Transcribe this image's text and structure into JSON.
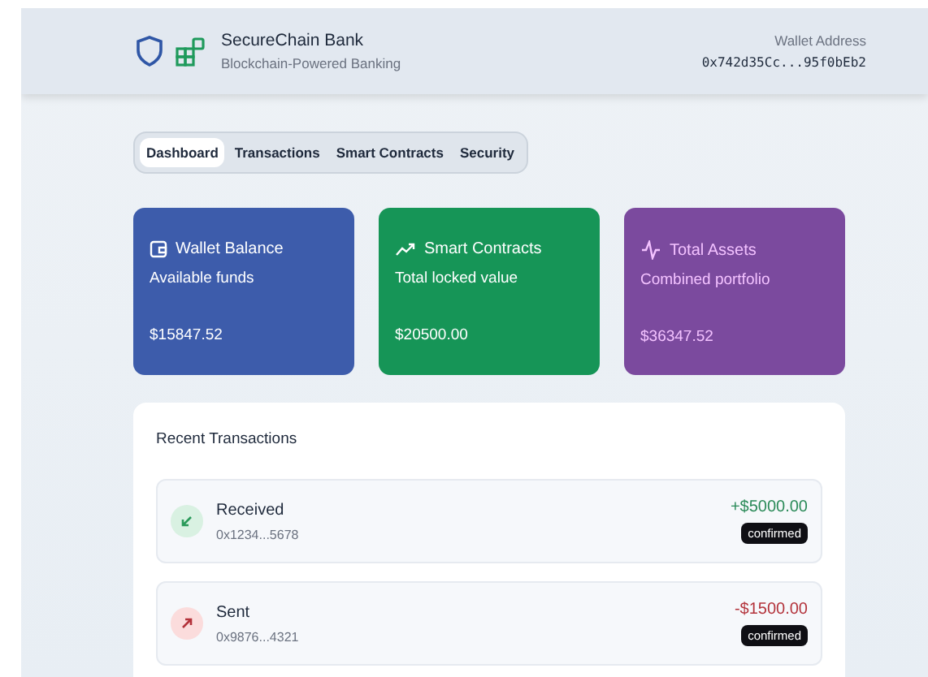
{
  "header": {
    "title": "SecureChain Bank",
    "subtitle": "Blockchain-Powered Banking",
    "wallet_label": "Wallet Address",
    "wallet_address": "0x742d35Cc...95f0bEb2"
  },
  "tabs": [
    {
      "label": "Dashboard",
      "selected": true
    },
    {
      "label": "Transactions",
      "selected": false
    },
    {
      "label": "Smart Contracts",
      "selected": false
    },
    {
      "label": "Security",
      "selected": false
    }
  ],
  "cards": [
    {
      "kind": "wallet",
      "title": "Wallet Balance",
      "subtitle": "Available funds",
      "amount": "$15847.52"
    },
    {
      "kind": "trend",
      "title": "Smart Contracts",
      "subtitle": "Total locked value",
      "amount": "$20500.00"
    },
    {
      "kind": "activity",
      "title": "Total Assets",
      "subtitle": "Combined portfolio",
      "amount": "$36347.52"
    }
  ],
  "recent": {
    "title": "Recent Transactions",
    "rows": [
      {
        "kind": "received",
        "label": "Received",
        "address": "0x1234...5678",
        "amount": "+$5000.00",
        "status": "confirmed"
      },
      {
        "kind": "sent",
        "label": "Sent",
        "address": "0x9876...4321",
        "amount": "-$1500.00",
        "status": "confirmed"
      }
    ]
  }
}
